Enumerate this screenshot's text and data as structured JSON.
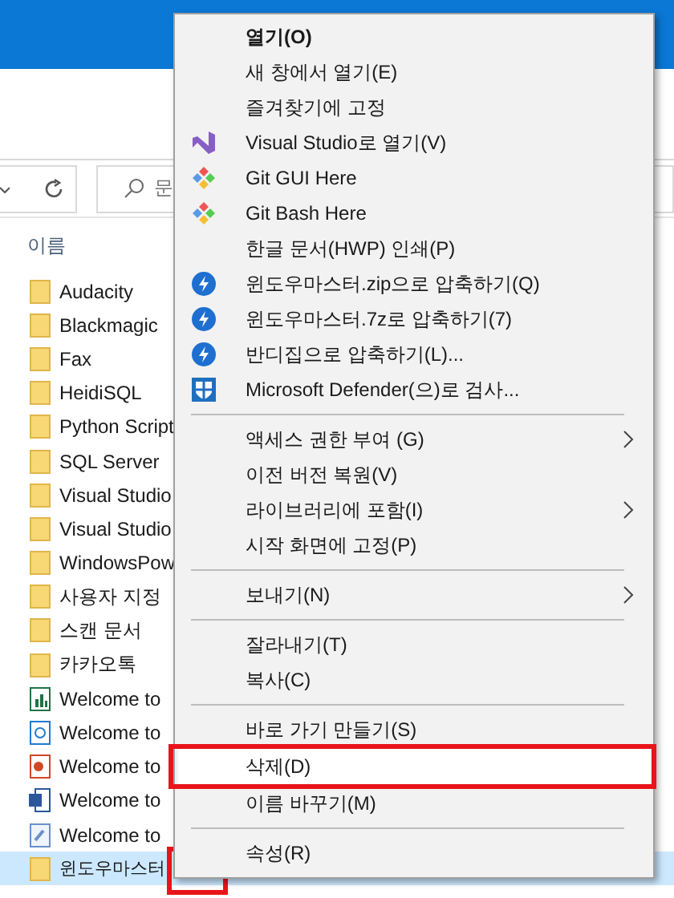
{
  "search": {
    "placeholder": "문"
  },
  "column_header": "이름",
  "files": [
    {
      "name": "Audacity",
      "kind": "folder",
      "selected": false,
      "framed": false
    },
    {
      "name": "Blackmagic",
      "kind": "folder",
      "selected": false,
      "framed": false
    },
    {
      "name": "Fax",
      "kind": "folder",
      "selected": false,
      "framed": false
    },
    {
      "name": "HeidiSQL",
      "kind": "folder",
      "selected": false,
      "framed": false
    },
    {
      "name": "Python Script",
      "kind": "folder",
      "selected": false,
      "framed": false
    },
    {
      "name": "SQL Server",
      "kind": "folder",
      "selected": false,
      "framed": false
    },
    {
      "name": "Visual Studio",
      "kind": "folder",
      "selected": false,
      "framed": false
    },
    {
      "name": "Visual Studio",
      "kind": "folder",
      "selected": false,
      "framed": false
    },
    {
      "name": "WindowsPow",
      "kind": "folder",
      "selected": false,
      "framed": false
    },
    {
      "name": "사용자 지정",
      "kind": "folder",
      "selected": false,
      "framed": false
    },
    {
      "name": "스캔 문서",
      "kind": "folder",
      "selected": false,
      "framed": false
    },
    {
      "name": "카카오톡",
      "kind": "folder",
      "selected": false,
      "framed": false
    },
    {
      "name": "Welcome to",
      "kind": "sheet",
      "selected": false,
      "framed": false
    },
    {
      "name": "Welcome to",
      "kind": "hangul",
      "selected": false,
      "framed": false
    },
    {
      "name": "Welcome to",
      "kind": "slides",
      "selected": false,
      "framed": false
    },
    {
      "name": "Welcome to",
      "kind": "word",
      "selected": false,
      "framed": false
    },
    {
      "name": "Welcome to",
      "kind": "note",
      "selected": false,
      "framed": false
    },
    {
      "name": "윈도우마스터",
      "kind": "folder",
      "selected": true,
      "framed": true
    }
  ],
  "context_menu": {
    "items": [
      {
        "kind": "plain",
        "label": "열기(O)",
        "default": true,
        "submenu": false,
        "selected": false,
        "framed": false
      },
      {
        "kind": "plain",
        "label": "새 창에서 열기(E)",
        "default": false,
        "submenu": false,
        "selected": false,
        "framed": false
      },
      {
        "kind": "plain",
        "label": "즐겨찾기에 고정",
        "default": false,
        "submenu": false,
        "selected": false,
        "framed": false
      },
      {
        "kind": "studio",
        "label": "Visual Studio로 열기(V)",
        "default": false,
        "submenu": false,
        "selected": false,
        "framed": false
      },
      {
        "kind": "git",
        "label": "Git GUI Here",
        "default": false,
        "submenu": false,
        "selected": false,
        "framed": false
      },
      {
        "kind": "git",
        "label": "Git Bash Here",
        "default": false,
        "submenu": false,
        "selected": false,
        "framed": false
      },
      {
        "kind": "plain",
        "label": "한글 문서(HWP) 인쇄(P)",
        "default": false,
        "submenu": false,
        "selected": false,
        "framed": false
      },
      {
        "kind": "zip",
        "label": "윈도우마스터.zip으로 압축하기(Q)",
        "default": false,
        "submenu": false,
        "selected": false,
        "framed": false
      },
      {
        "kind": "zip",
        "label": "윈도우마스터.7z로 압축하기(7)",
        "default": false,
        "submenu": false,
        "selected": false,
        "framed": false
      },
      {
        "kind": "zip",
        "label": "반디집으로 압축하기(L)...",
        "default": false,
        "submenu": false,
        "selected": false,
        "framed": false
      },
      {
        "kind": "shield",
        "label": "Microsoft Defender(으)로 검사...",
        "default": false,
        "submenu": false,
        "selected": false,
        "framed": false
      },
      {
        "kind": "separator"
      },
      {
        "kind": "plain",
        "label": "액세스 권한 부여 (G)",
        "default": false,
        "submenu": true,
        "selected": false,
        "framed": false
      },
      {
        "kind": "plain",
        "label": "이전 버전 복원(V)",
        "default": false,
        "submenu": false,
        "selected": false,
        "framed": false
      },
      {
        "kind": "plain",
        "label": "라이브러리에 포함(I)",
        "default": false,
        "submenu": true,
        "selected": false,
        "framed": false
      },
      {
        "kind": "plain",
        "label": "시작 화면에 고정(P)",
        "default": false,
        "submenu": false,
        "selected": false,
        "framed": false
      },
      {
        "kind": "separator"
      },
      {
        "kind": "plain",
        "label": "보내기(N)",
        "default": false,
        "submenu": true,
        "selected": false,
        "framed": false
      },
      {
        "kind": "separator"
      },
      {
        "kind": "plain",
        "label": "잘라내기(T)",
        "default": false,
        "submenu": false,
        "selected": false,
        "framed": false
      },
      {
        "kind": "plain",
        "label": "복사(C)",
        "default": false,
        "submenu": false,
        "selected": false,
        "framed": false
      },
      {
        "kind": "separator"
      },
      {
        "kind": "plain",
        "label": "바로 가기 만들기(S)",
        "default": false,
        "submenu": false,
        "selected": false,
        "framed": false
      },
      {
        "kind": "plain",
        "label": "삭제(D)",
        "default": false,
        "submenu": false,
        "selected": true,
        "framed": true
      },
      {
        "kind": "plain",
        "label": "이름 바꾸기(M)",
        "default": false,
        "submenu": false,
        "selected": false,
        "framed": false
      },
      {
        "kind": "separator"
      },
      {
        "kind": "plain",
        "label": "속성(R)",
        "default": false,
        "submenu": false,
        "selected": false,
        "framed": false
      }
    ]
  }
}
